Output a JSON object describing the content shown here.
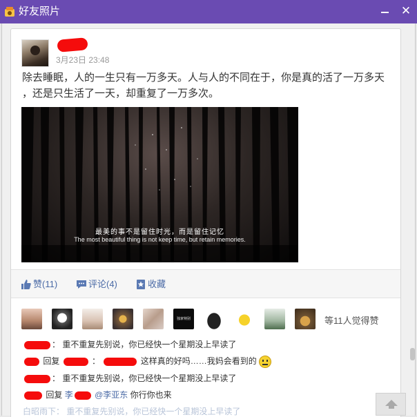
{
  "window": {
    "title": "好友照片",
    "minimize_label": "",
    "close_label": "✕"
  },
  "post": {
    "time": "3月23日 23:48",
    "line1": "除去睡眠，人的一生只有一万多天。人与人的不同在于，你是真的活了一万多天",
    "line2": "，还是只生活了一天，却重复了一万多次。",
    "image": {
      "subtitle_cn": "最美的事不是留住时光，而是留住记忆",
      "subtitle_en": "The most beautiful thing is not keep time, but retain memories."
    }
  },
  "actions": {
    "like": "赞(11)",
    "comment": "评论(4)",
    "favorite": "收藏"
  },
  "likers": {
    "summary": "等11人觉得赞",
    "avatar_badge": "独家特别"
  },
  "comments": [
    {
      "name": "",
      "sep": "：",
      "text": "重不重复先别说，你已经快一个星期没上早读了"
    },
    {
      "reply": "回复",
      "target": "",
      "name": "",
      "sep": "：",
      "text": "这样真的好吗……我妈会看到的"
    },
    {
      "name": "",
      "sep": "：",
      "text": "重不重复先别说，你已经快一个星期没上早读了"
    },
    {
      "reply": "回复",
      "target": "李",
      "mention": "@李亚东",
      "text": "你行你也来"
    },
    {
      "name": "白昭雨下",
      "sep": "：",
      "text": "重不重复先别说，你已经快一个星期没上早读了"
    }
  ],
  "colors": {
    "titlebar": "#6a4bb2",
    "link": "#4a6aa6",
    "redaction": "#f50c0c"
  },
  "icons": [
    "window-icon",
    "minimize-icon",
    "close-icon",
    "thumbs-up-icon",
    "comment-icon",
    "bookmark-icon",
    "smiley-icon",
    "arrow-up-icon"
  ]
}
